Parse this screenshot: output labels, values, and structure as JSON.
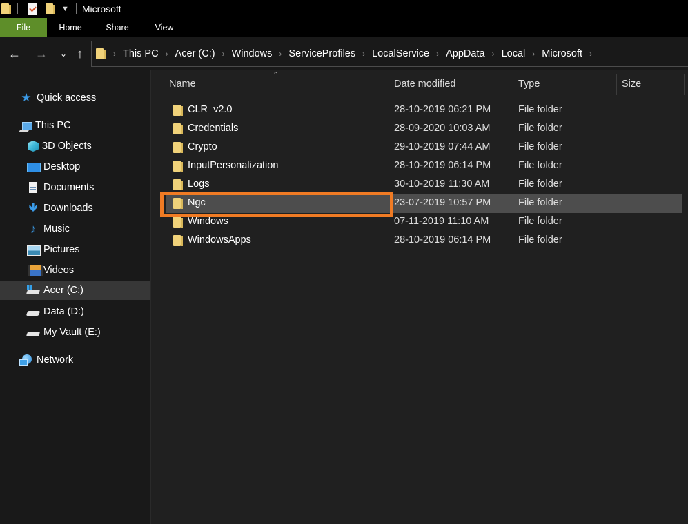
{
  "window": {
    "title": "Microsoft",
    "quick_access_toolbar": [
      "folder-icon",
      "properties-icon",
      "new-folder-icon",
      "customize-dropdown-icon"
    ]
  },
  "ribbon": {
    "tabs": [
      {
        "label": "File",
        "active": true,
        "color": "#5e8e29"
      },
      {
        "label": "Home"
      },
      {
        "label": "Share"
      },
      {
        "label": "View"
      }
    ]
  },
  "navigation": {
    "back": "←",
    "forward": "→",
    "recent": "⌄",
    "up": "↑",
    "breadcrumb": [
      "This PC",
      "Acer (C:)",
      "Windows",
      "ServiceProfiles",
      "LocalService",
      "AppData",
      "Local",
      "Microsoft"
    ],
    "separator": "›"
  },
  "sidebar": {
    "items": [
      {
        "label": "Quick access",
        "icon": "star-icon",
        "level": 1
      },
      {
        "label": "This PC",
        "icon": "computer-icon",
        "level": 1
      },
      {
        "label": "3D Objects",
        "icon": "3d-objects-icon",
        "level": 2
      },
      {
        "label": "Desktop",
        "icon": "desktop-icon",
        "level": 2
      },
      {
        "label": "Documents",
        "icon": "documents-icon",
        "level": 2
      },
      {
        "label": "Downloads",
        "icon": "download-icon",
        "level": 2
      },
      {
        "label": "Music",
        "icon": "music-icon",
        "level": 2
      },
      {
        "label": "Pictures",
        "icon": "pictures-icon",
        "level": 2
      },
      {
        "label": "Videos",
        "icon": "videos-icon",
        "level": 2
      },
      {
        "label": "Acer (C:)",
        "icon": "windows-drive-icon",
        "level": 2,
        "selected": true
      },
      {
        "label": "Data (D:)",
        "icon": "drive-icon",
        "level": 2
      },
      {
        "label": "My Vault (E:)",
        "icon": "drive-icon",
        "level": 2
      },
      {
        "label": "Network",
        "icon": "network-icon",
        "level": 1
      }
    ]
  },
  "file_list": {
    "sort_indicator": "^",
    "columns": [
      "Name",
      "Date modified",
      "Type",
      "Size"
    ],
    "rows": [
      {
        "name": "CLR_v2.0",
        "date": "28-10-2019 06:21 PM",
        "type": "File folder",
        "size": ""
      },
      {
        "name": "Credentials",
        "date": "28-09-2020 10:03 AM",
        "type": "File folder",
        "size": ""
      },
      {
        "name": "Crypto",
        "date": "29-10-2019 07:44 AM",
        "type": "File folder",
        "size": ""
      },
      {
        "name": "InputPersonalization",
        "date": "28-10-2019 06:14 PM",
        "type": "File folder",
        "size": ""
      },
      {
        "name": "Logs",
        "date": "30-10-2019 11:30 AM",
        "type": "File folder",
        "size": ""
      },
      {
        "name": "Ngc",
        "date": "23-07-2019 10:57 PM",
        "type": "File folder",
        "size": "",
        "selected": true,
        "highlighted": true
      },
      {
        "name": "Windows",
        "date": "07-11-2019 11:10 AM",
        "type": "File folder",
        "size": ""
      },
      {
        "name": "WindowsApps",
        "date": "28-10-2019 06:14 PM",
        "type": "File folder",
        "size": ""
      }
    ]
  },
  "annotation": {
    "highlight_color": "#f07b24",
    "target_row": "Ngc"
  }
}
